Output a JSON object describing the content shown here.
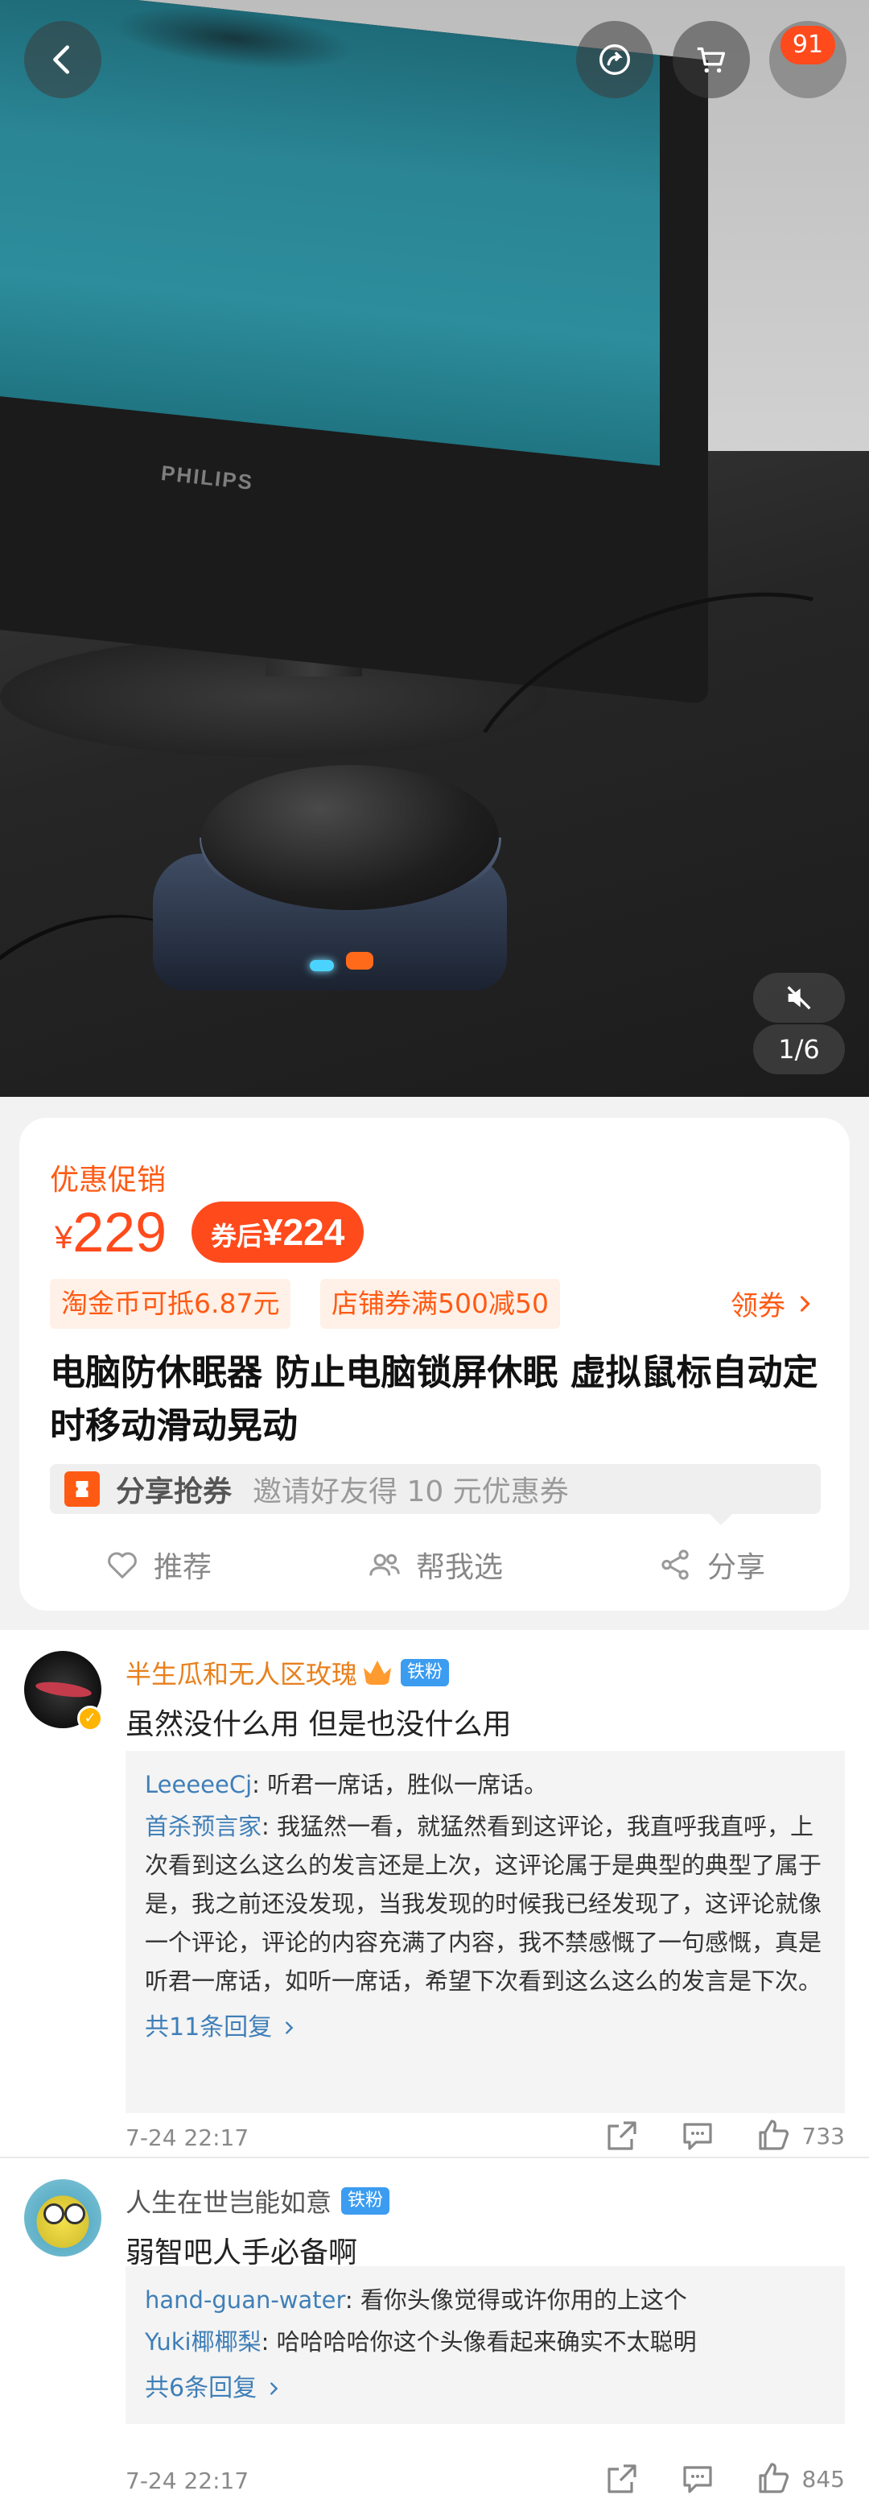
{
  "hero": {
    "monitor_brand": "PHILIPS",
    "pager": "1/6",
    "cart_badge": "91"
  },
  "product": {
    "promo_label": "优惠促销",
    "currency": "¥",
    "price": "229",
    "coupon_prefix": "券后",
    "coupon_price": "¥224",
    "tags": [
      "淘金币可抵6.87元",
      "店铺券满500减50"
    ],
    "get_coupon": "领券",
    "title": "电脑防休眠器 防止电脑锁屏休眠 虚拟鼠标自动定时移动滑动晃动",
    "share_label": "分享抢券",
    "share_desc": "邀请好友得 10 元优惠券",
    "actions": [
      "推荐",
      "帮我选",
      "分享"
    ]
  },
  "comments": [
    {
      "user": "半生瓜和无人区玫瑰",
      "badge": "铁粉",
      "text": "虽然没什么用 但是也没什么用",
      "replies": [
        {
          "name": "LeeeeeCj",
          "text": "听君一席话，胜似一席话。"
        },
        {
          "name": "首杀预言家",
          "text": "我猛然一看，就猛然看到这评论，我直呼我直呼，上次看到这么这么的发言还是上次，这评论属于是典型的典型了属于是，我之前还没发现，当我发现的时候我已经发现了，这评论就像一个评论，评论的内容充满了内容，我不禁感慨了一句感慨，真是听君一席话，如听一席话，希望下次看到这么这么的发言是下次。"
        }
      ],
      "more_replies": "共11条回复",
      "time": "7-24 22:17",
      "likes": "733"
    },
    {
      "user": "人生在世岂能如意",
      "badge": "铁粉",
      "text": "弱智吧人手必备啊",
      "replies": [
        {
          "name": "hand-guan-water",
          "text": "看你头像觉得或许你用的上这个"
        },
        {
          "name": "Yuki椰椰梨",
          "text": "哈哈哈哈你这个头像看起来确实不太聪明"
        }
      ],
      "more_replies": "共6条回复",
      "time": "7-24 22:17",
      "likes": "845"
    }
  ],
  "colors": {
    "accent": "#ff4a1c",
    "link": "#3f7fb8",
    "username_orange": "#e8801c",
    "fan_badge": "#3b9cf0"
  }
}
